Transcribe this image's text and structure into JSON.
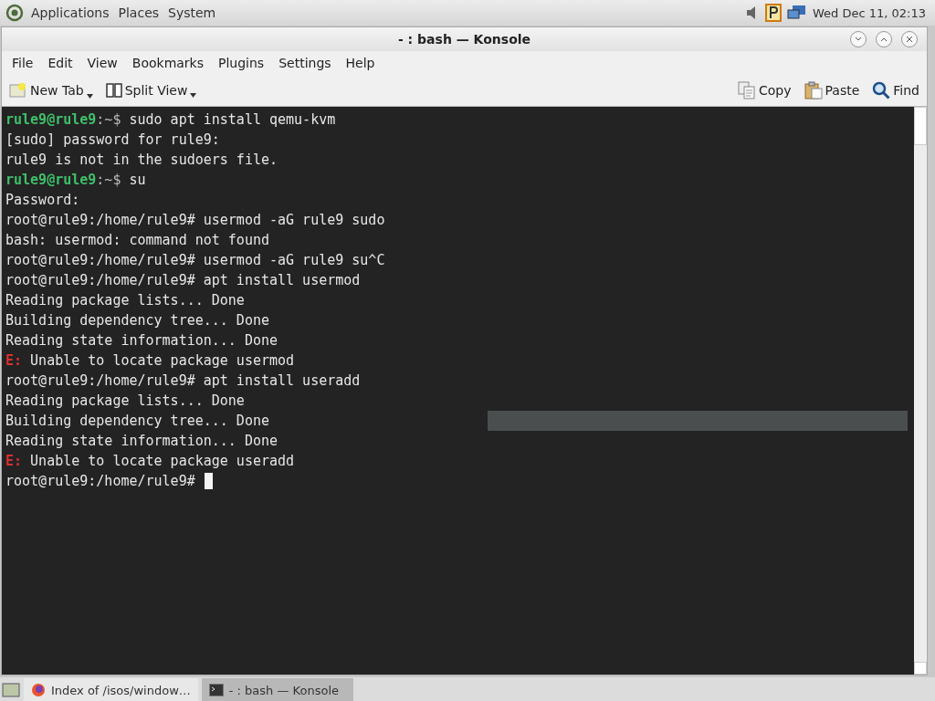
{
  "top_panel": {
    "menus": [
      "Applications",
      "Places",
      "System"
    ],
    "clock": "Wed Dec 11, 02:13"
  },
  "window": {
    "title": "- : bash — Konsole"
  },
  "menu_bar": [
    "File",
    "Edit",
    "View",
    "Bookmarks",
    "Plugins",
    "Settings",
    "Help"
  ],
  "toolbar": {
    "left": [
      {
        "label": "New Tab",
        "kind": "new-tab"
      },
      {
        "label": "Split View",
        "kind": "split"
      }
    ],
    "right": [
      {
        "label": "Copy",
        "kind": "copy"
      },
      {
        "label": "Paste",
        "kind": "paste"
      },
      {
        "label": "Find",
        "kind": "find"
      }
    ]
  },
  "terminal": {
    "lines": [
      {
        "kind": "user",
        "prompt": "rule9@rule9",
        "path": ":~$",
        "text": " sudo apt install qemu-kvm"
      },
      {
        "kind": "plain",
        "text": "[sudo] password for rule9:"
      },
      {
        "kind": "plain",
        "text": "rule9 is not in the sudoers file."
      },
      {
        "kind": "user",
        "prompt": "rule9@rule9",
        "path": ":~$",
        "text": " su"
      },
      {
        "kind": "plain",
        "text": "Password:"
      },
      {
        "kind": "plain",
        "text": "root@rule9:/home/rule9# usermod -aG rule9 sudo"
      },
      {
        "kind": "plain",
        "text": "bash: usermod: command not found"
      },
      {
        "kind": "plain",
        "text": "root@rule9:/home/rule9# usermod -aG rule9 su^C"
      },
      {
        "kind": "plain",
        "text": "root@rule9:/home/rule9# apt install usermod"
      },
      {
        "kind": "plain",
        "text": "Reading package lists... Done"
      },
      {
        "kind": "plain",
        "text": "Building dependency tree... Done"
      },
      {
        "kind": "plain",
        "text": "Reading state information... Done"
      },
      {
        "kind": "error",
        "prompt": "E:",
        "text": " Unable to locate package usermod"
      },
      {
        "kind": "plain",
        "text": "root@rule9:/home/rule9# apt install useradd"
      },
      {
        "kind": "plain",
        "text": "Reading package lists... Done"
      },
      {
        "kind": "plain",
        "text": "Building dependency tree... Done",
        "highlight": true
      },
      {
        "kind": "plain",
        "text": "Reading state information... Done"
      },
      {
        "kind": "error",
        "prompt": "E:",
        "text": " Unable to locate package useradd"
      },
      {
        "kind": "cursor",
        "text": "root@rule9:/home/rule9# "
      }
    ]
  },
  "taskbar": {
    "tasks": [
      {
        "label": "Index of /isos/window…",
        "kind": "browser",
        "selected": false
      },
      {
        "label": "- : bash — Konsole",
        "kind": "terminal",
        "selected": true
      }
    ]
  }
}
